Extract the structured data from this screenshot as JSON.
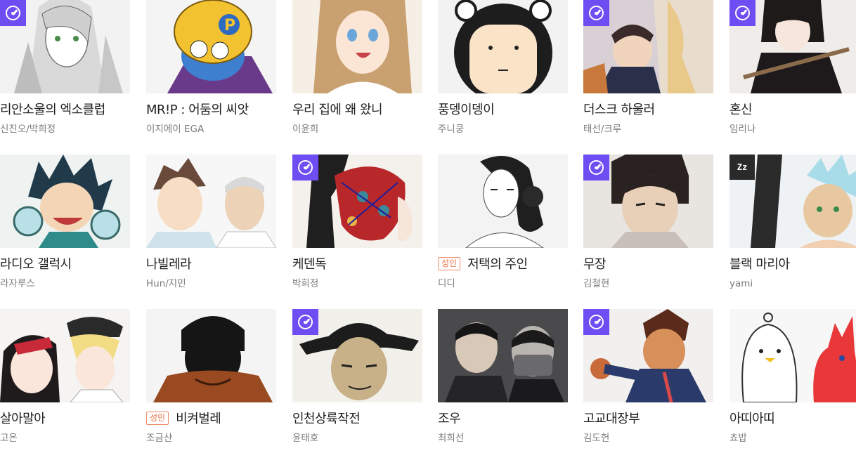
{
  "badge_text": {
    "zz": "Zz",
    "adult": "성인"
  },
  "colors": {
    "badge_purple": "#6e4df2",
    "adult_orange": "#ef6f45"
  },
  "rows": [
    [
      {
        "title": "리안소울의 엑소클럽",
        "author": "신진오/박희정",
        "badge": "clock-icon",
        "adult": false
      },
      {
        "title": "MR!P : 어둠의 씨앗",
        "author": "이지에이 EGA",
        "badge": "",
        "adult": false
      },
      {
        "title": "우리 집에 왜 왔니",
        "author": "이윤희",
        "badge": "",
        "adult": false
      },
      {
        "title": "풍뎅이뎅이",
        "author": "주니쿵",
        "badge": "",
        "adult": false
      },
      {
        "title": "더스크 하울러",
        "author": "태선/크루",
        "badge": "clock-icon",
        "adult": false
      },
      {
        "title": "혼신",
        "author": "임리나",
        "badge": "clock-icon",
        "adult": false
      }
    ],
    [
      {
        "title": "라디오 갤럭시",
        "author": "라자루스",
        "badge": "",
        "adult": false
      },
      {
        "title": "나빌레라",
        "author": "Hun/지민",
        "badge": "",
        "adult": false
      },
      {
        "title": "케덴독",
        "author": "박희정",
        "badge": "clock-icon",
        "adult": false
      },
      {
        "title": "저택의 주인",
        "author": "디디",
        "badge": "",
        "adult": true
      },
      {
        "title": "무장",
        "author": "김철현",
        "badge": "clock-icon",
        "adult": false
      },
      {
        "title": "블랙 마리아",
        "author": "yami",
        "badge": "zz-icon",
        "adult": false
      }
    ],
    [
      {
        "title": "살아말아",
        "author": "고은",
        "badge": "",
        "adult": false
      },
      {
        "title": "비켜벌레",
        "author": "조금산",
        "badge": "",
        "adult": true
      },
      {
        "title": "인천상륙작전",
        "author": "윤태호",
        "badge": "clock-icon",
        "adult": false
      },
      {
        "title": "조우",
        "author": "최희선",
        "badge": "",
        "adult": false
      },
      {
        "title": "고교대장부",
        "author": "김도헌",
        "badge": "clock-icon",
        "adult": false
      },
      {
        "title": "아띠아띠",
        "author": "쵸밥",
        "badge": "",
        "adult": false
      }
    ]
  ]
}
